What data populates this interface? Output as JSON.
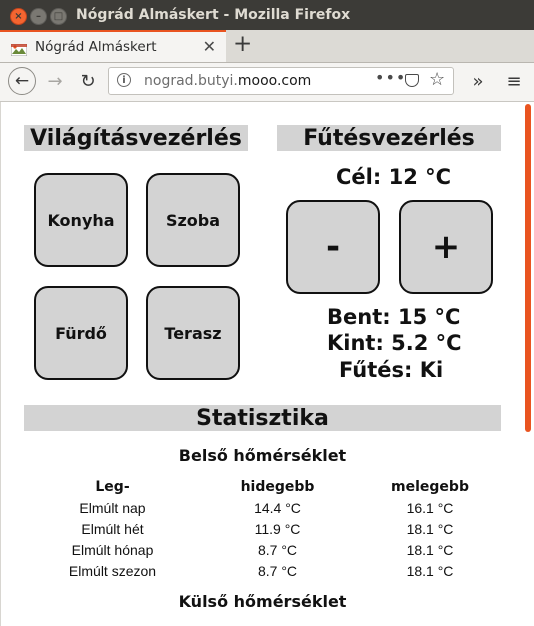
{
  "window": {
    "title": "Nógrád Almáskert - Mozilla Firefox",
    "close_glyph": "×",
    "min_glyph": "–",
    "max_glyph": "□"
  },
  "tab": {
    "title": "Nógrád Almáskert",
    "close_glyph": "✕",
    "new_tab_glyph": "+"
  },
  "nav": {
    "back_glyph": "←",
    "forward_glyph": "→",
    "reload_glyph": "↻",
    "url_prefix": "nograd.butyi.",
    "url_domain": "mooo.com",
    "info_glyph": "i",
    "page_actions_glyph": "•••",
    "bookmark_glyph": "☆",
    "overflow_glyph": "»",
    "menu_glyph": "≡"
  },
  "lights": {
    "title": "Világításvezérlés",
    "buttons": [
      "Konyha",
      "Szoba",
      "Fürdő",
      "Terasz"
    ]
  },
  "heating": {
    "title": "Fűtésvezérlés",
    "target_label": "Cél:",
    "target_value": "12 °C",
    "minus_label": "-",
    "plus_label": "+",
    "inside_label": "Bent:",
    "inside_value": "15 °C",
    "outside_label": "Kint:",
    "outside_value": "5.2 °C",
    "status_label": "Fűtés:",
    "status_value": "Ki"
  },
  "stats": {
    "title": "Statisztika",
    "inside_heading": "Belső hőmérséklet",
    "outside_heading": "Külső hőmérséklet",
    "columns": [
      "Leg-",
      "hidegebb",
      "melegebb"
    ],
    "rows": [
      [
        "Elmúlt nap",
        "14.4 °C",
        "16.1 °C"
      ],
      [
        "Elmúlt hét",
        "11.9 °C",
        "18.1 °C"
      ],
      [
        "Elmúlt hónap",
        "8.7 °C",
        "18.1 °C"
      ],
      [
        "Elmúlt szezon",
        "8.7 °C",
        "18.1 °C"
      ]
    ]
  },
  "colors": {
    "accent": "#e95420",
    "panel_gray": "#d3d3d3",
    "titlebar": "#3c3b37"
  }
}
